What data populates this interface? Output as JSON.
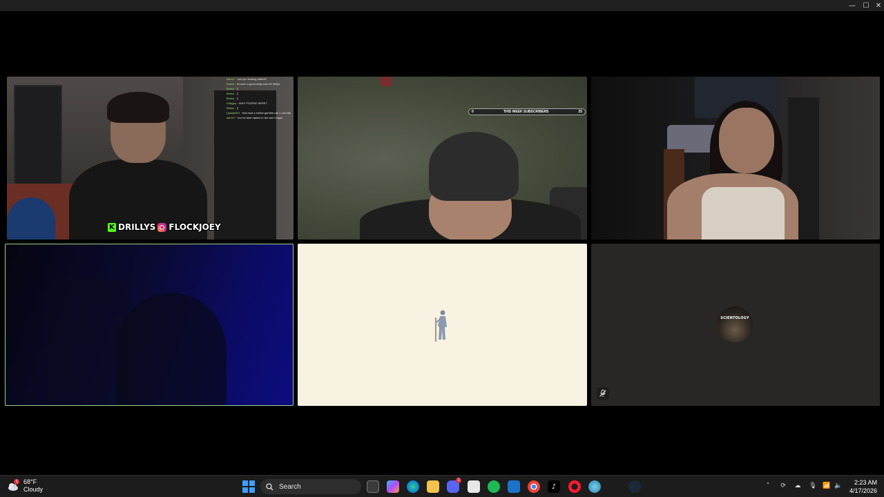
{
  "window": {
    "minimize_glyph": "—",
    "maximize_glyph": "☐",
    "close_glyph": "✕"
  },
  "tiles": [
    {
      "id": "participant-1",
      "chat_lines": [
        {
          "user": "sarrr47",
          "text": "are you fucking visited?"
        },
        {
          "user": "Brinkz",
          "text": "im such a good wing man for drillys"
        },
        {
          "user": "Brinkz",
          "text": "▯"
        },
        {
          "user": "Brinkz",
          "text": "▯"
        },
        {
          "user": "Brinkz",
          "text": "▯"
        },
        {
          "user": "Eddyjay",
          "text": "WHY POOPAT HERE?"
        },
        {
          "user": "Brinkz",
          "text": "▯"
        },
        {
          "user": "Update001",
          "text": "this bout a sixfive gamble call u can talk"
        },
        {
          "user": "sarrr47",
          "text": "bro he been talked in the last 3 sayin"
        }
      ],
      "overlay_handle_kick": "DRILLYS",
      "overlay_handle_ig": "FLOCKJOEY",
      "kick_letter": "K"
    },
    {
      "id": "participant-2",
      "subs_bar": {
        "left_count": "0",
        "label": "THIS WEEK SUBSCRIBERS",
        "right_count": "25",
        "progress": 0.0
      }
    },
    {
      "id": "participant-3"
    },
    {
      "id": "participant-4",
      "active_speaker": true
    },
    {
      "id": "participant-5",
      "avatar": "standing-figure-icon"
    },
    {
      "id": "participant-6",
      "avatar_text": "SCIENTOLOGY",
      "mic_muted": true
    }
  ],
  "taskbar": {
    "weather": {
      "temp": "68°F",
      "condition": "Cloudy",
      "badge": "1"
    },
    "search_placeholder": "Search",
    "apps": [
      {
        "name": "task-view-icon"
      },
      {
        "name": "copilot-icon"
      },
      {
        "name": "edge-icon"
      },
      {
        "name": "file-explorer-icon"
      },
      {
        "name": "discord-icon",
        "badge": "1"
      },
      {
        "name": "store-icon"
      },
      {
        "name": "spotify-icon"
      },
      {
        "name": "outlook-icon"
      },
      {
        "name": "chrome-icon"
      },
      {
        "name": "tiktok-icon"
      },
      {
        "name": "opera-icon"
      },
      {
        "name": "browser-icon"
      },
      {
        "name": "steam-icon"
      }
    ],
    "clock": {
      "time": "2:23 AM",
      "date": "4/17/2026"
    }
  },
  "colors": {
    "active_speaker_border": "#9bd38b",
    "kick_green": "#53fc18",
    "start_blue": "#3ba0ff"
  }
}
